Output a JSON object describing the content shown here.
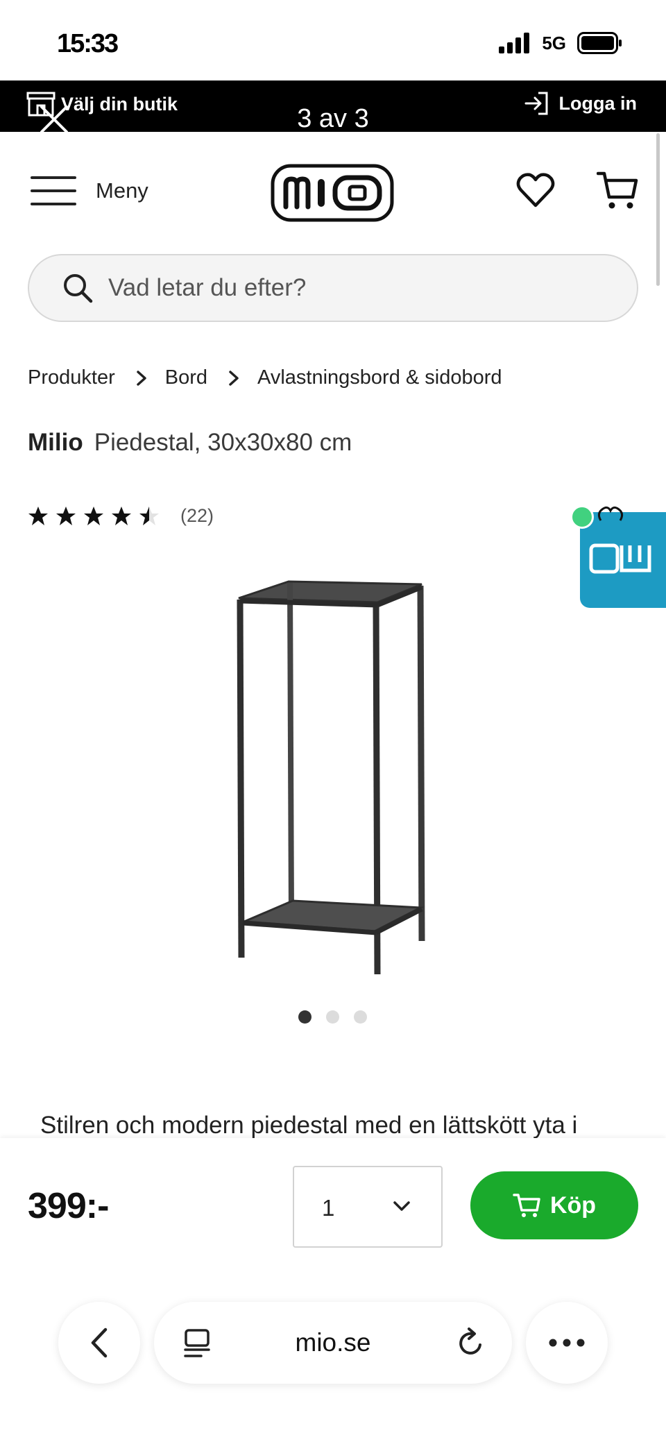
{
  "status_bar": {
    "time": "15:33",
    "network": "5G"
  },
  "top_strip": {
    "store_label": "Välj din butik",
    "viewer_count": "3 av 3",
    "login_label": "Logga in"
  },
  "header": {
    "menu_label": "Meny",
    "logo_text": "MIO"
  },
  "search": {
    "placeholder": "Vad letar du efter?"
  },
  "breadcrumb": [
    "Produkter",
    "Bord",
    "Avlastningsbord & sidobord"
  ],
  "product": {
    "brand": "Milio",
    "name": "Piedestal, 30x30x80 cm",
    "rating": 4.5,
    "review_count": "(22)",
    "image_count": 3,
    "active_image": 1,
    "description": "Stilren och modern piedestal med en lättskött yta i"
  },
  "buy_bar": {
    "price": "399:-",
    "quantity": "1",
    "buy_label": "Köp"
  },
  "browser": {
    "url": "mio.se"
  },
  "colors": {
    "buy_green": "#1aaa2c",
    "widget_blue": "#1d9bc3",
    "top_strip": "#000000"
  },
  "icons": {
    "store": "store-icon",
    "close": "close-icon",
    "login": "login-icon",
    "menu": "hamburger-icon",
    "wishlist": "heart-icon",
    "cart": "cart-icon",
    "search": "search-icon",
    "back": "chevron-left-icon",
    "reload": "reload-icon",
    "more": "more-icon"
  }
}
